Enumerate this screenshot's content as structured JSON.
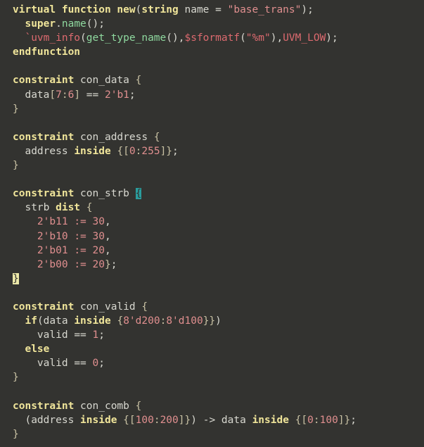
{
  "editor": {
    "language": "SystemVerilog",
    "theme": "dark-warm-gray",
    "background": "#333330",
    "bracket_match_open_bg": "#2a9d9d",
    "bracket_match_close_bg": "#ece8a8",
    "colors": {
      "keyword": "#f0e59a",
      "identifier": "#d8d8d0",
      "function": "#8fd99f",
      "macro": "#dd6a6f",
      "string": "#e08f8f",
      "number": "#e08f8f",
      "punctuation": "#c9c2a4"
    }
  },
  "code": {
    "lines": [
      {
        "n": 1,
        "tokens": [
          {
            "t": "kw",
            "v": "virtual"
          },
          {
            "t": "id",
            "v": " "
          },
          {
            "t": "kw",
            "v": "function"
          },
          {
            "t": "id",
            "v": " "
          },
          {
            "t": "kw",
            "v": "new"
          },
          {
            "t": "op",
            "v": "("
          },
          {
            "t": "kw",
            "v": "string"
          },
          {
            "t": "id",
            "v": " name "
          },
          {
            "t": "op",
            "v": "= "
          },
          {
            "t": "str",
            "v": "\"base_trans\""
          },
          {
            "t": "op",
            "v": ");"
          }
        ]
      },
      {
        "n": 2,
        "tokens": [
          {
            "t": "id",
            "v": "  "
          },
          {
            "t": "kw",
            "v": "super"
          },
          {
            "t": "op",
            "v": "."
          },
          {
            "t": "fn",
            "v": "name"
          },
          {
            "t": "op",
            "v": "();"
          }
        ]
      },
      {
        "n": 3,
        "tokens": [
          {
            "t": "id",
            "v": "  "
          },
          {
            "t": "mac",
            "v": "`uvm_info"
          },
          {
            "t": "op",
            "v": "("
          },
          {
            "t": "fn",
            "v": "get_type_name"
          },
          {
            "t": "op",
            "v": "(),"
          },
          {
            "t": "mac",
            "v": "$sformatf"
          },
          {
            "t": "op",
            "v": "("
          },
          {
            "t": "mac",
            "v": "\"%m\""
          },
          {
            "t": "op",
            "v": "),"
          },
          {
            "t": "mac",
            "v": "UVM_LOW"
          },
          {
            "t": "op",
            "v": ");"
          }
        ]
      },
      {
        "n": 4,
        "tokens": [
          {
            "t": "kw",
            "v": "endfunction"
          }
        ]
      },
      {
        "n": 5,
        "tokens": []
      },
      {
        "n": 6,
        "tokens": [
          {
            "t": "kw",
            "v": "constraint"
          },
          {
            "t": "id",
            "v": " con_data "
          },
          {
            "t": "pun",
            "v": "{"
          }
        ]
      },
      {
        "n": 7,
        "tokens": [
          {
            "t": "id",
            "v": "  data"
          },
          {
            "t": "pun",
            "v": "["
          },
          {
            "t": "num",
            "v": "7"
          },
          {
            "t": "pun",
            "v": ":"
          },
          {
            "t": "num",
            "v": "6"
          },
          {
            "t": "pun",
            "v": "]"
          },
          {
            "t": "op",
            "v": " == "
          },
          {
            "t": "num",
            "v": "2'b1"
          },
          {
            "t": "op",
            "v": ";"
          }
        ]
      },
      {
        "n": 8,
        "tokens": [
          {
            "t": "pun",
            "v": "}"
          }
        ]
      },
      {
        "n": 9,
        "tokens": []
      },
      {
        "n": 10,
        "tokens": [
          {
            "t": "kw",
            "v": "constraint"
          },
          {
            "t": "id",
            "v": " con_address "
          },
          {
            "t": "pun",
            "v": "{"
          }
        ]
      },
      {
        "n": 11,
        "tokens": [
          {
            "t": "id",
            "v": "  address "
          },
          {
            "t": "kw",
            "v": "inside"
          },
          {
            "t": "id",
            "v": " "
          },
          {
            "t": "pun",
            "v": "{["
          },
          {
            "t": "num",
            "v": "0"
          },
          {
            "t": "pun",
            "v": ":"
          },
          {
            "t": "num",
            "v": "255"
          },
          {
            "t": "pun",
            "v": "]}"
          },
          {
            "t": "op",
            "v": ";"
          }
        ]
      },
      {
        "n": 12,
        "tokens": [
          {
            "t": "pun",
            "v": "}"
          }
        ]
      },
      {
        "n": 13,
        "tokens": []
      },
      {
        "n": 14,
        "tokens": [
          {
            "t": "kw",
            "v": "constraint"
          },
          {
            "t": "id",
            "v": " con_strb "
          },
          {
            "t": "hl-open",
            "v": "{"
          }
        ]
      },
      {
        "n": 15,
        "tokens": [
          {
            "t": "id",
            "v": "  strb "
          },
          {
            "t": "kw",
            "v": "dist"
          },
          {
            "t": "id",
            "v": " "
          },
          {
            "t": "pun",
            "v": "{"
          }
        ]
      },
      {
        "n": 16,
        "tokens": [
          {
            "t": "id",
            "v": "    "
          },
          {
            "t": "num",
            "v": "2'b11"
          },
          {
            "t": "op",
            "v": " "
          },
          {
            "t": "num",
            "v": ":="
          },
          {
            "t": "op",
            "v": " "
          },
          {
            "t": "num",
            "v": "30"
          },
          {
            "t": "op",
            "v": ","
          }
        ]
      },
      {
        "n": 17,
        "tokens": [
          {
            "t": "id",
            "v": "    "
          },
          {
            "t": "num",
            "v": "2'b10"
          },
          {
            "t": "op",
            "v": " "
          },
          {
            "t": "num",
            "v": ":="
          },
          {
            "t": "op",
            "v": " "
          },
          {
            "t": "num",
            "v": "30"
          },
          {
            "t": "op",
            "v": ","
          }
        ]
      },
      {
        "n": 18,
        "tokens": [
          {
            "t": "id",
            "v": "    "
          },
          {
            "t": "num",
            "v": "2'b01"
          },
          {
            "t": "op",
            "v": " "
          },
          {
            "t": "num",
            "v": ":="
          },
          {
            "t": "op",
            "v": " "
          },
          {
            "t": "num",
            "v": "20"
          },
          {
            "t": "op",
            "v": ","
          }
        ]
      },
      {
        "n": 19,
        "tokens": [
          {
            "t": "id",
            "v": "    "
          },
          {
            "t": "num",
            "v": "2'b00"
          },
          {
            "t": "op",
            "v": " "
          },
          {
            "t": "num",
            "v": ":="
          },
          {
            "t": "op",
            "v": " "
          },
          {
            "t": "num",
            "v": "20"
          },
          {
            "t": "pun",
            "v": "}"
          },
          {
            "t": "op",
            "v": ";"
          }
        ]
      },
      {
        "n": 20,
        "tokens": [
          {
            "t": "hl-close",
            "v": "}"
          }
        ]
      },
      {
        "n": 21,
        "tokens": []
      },
      {
        "n": 22,
        "tokens": [
          {
            "t": "kw",
            "v": "constraint"
          },
          {
            "t": "id",
            "v": " con_valid "
          },
          {
            "t": "pun",
            "v": "{"
          }
        ]
      },
      {
        "n": 23,
        "tokens": [
          {
            "t": "id",
            "v": "  "
          },
          {
            "t": "kw",
            "v": "if"
          },
          {
            "t": "op",
            "v": "("
          },
          {
            "t": "id",
            "v": "data "
          },
          {
            "t": "kw",
            "v": "inside"
          },
          {
            "t": "id",
            "v": " "
          },
          {
            "t": "pun",
            "v": "{"
          },
          {
            "t": "num",
            "v": "8'd200"
          },
          {
            "t": "pun",
            "v": ":"
          },
          {
            "t": "num",
            "v": "8'd100"
          },
          {
            "t": "pun",
            "v": "}}"
          },
          {
            "t": "op",
            "v": ")"
          }
        ]
      },
      {
        "n": 24,
        "tokens": [
          {
            "t": "id",
            "v": "    valid "
          },
          {
            "t": "op",
            "v": "== "
          },
          {
            "t": "num",
            "v": "1"
          },
          {
            "t": "op",
            "v": ";"
          }
        ]
      },
      {
        "n": 25,
        "tokens": [
          {
            "t": "id",
            "v": "  "
          },
          {
            "t": "kw",
            "v": "else"
          }
        ]
      },
      {
        "n": 26,
        "tokens": [
          {
            "t": "id",
            "v": "    valid "
          },
          {
            "t": "op",
            "v": "== "
          },
          {
            "t": "num",
            "v": "0"
          },
          {
            "t": "op",
            "v": ";"
          }
        ]
      },
      {
        "n": 27,
        "tokens": [
          {
            "t": "pun",
            "v": "}"
          }
        ]
      },
      {
        "n": 28,
        "tokens": []
      },
      {
        "n": 29,
        "tokens": [
          {
            "t": "kw",
            "v": "constraint"
          },
          {
            "t": "id",
            "v": " con_comb "
          },
          {
            "t": "pun",
            "v": "{"
          }
        ]
      },
      {
        "n": 30,
        "tokens": [
          {
            "t": "id",
            "v": "  "
          },
          {
            "t": "op",
            "v": "("
          },
          {
            "t": "id",
            "v": "address "
          },
          {
            "t": "kw",
            "v": "inside"
          },
          {
            "t": "id",
            "v": " "
          },
          {
            "t": "pun",
            "v": "{["
          },
          {
            "t": "num",
            "v": "100"
          },
          {
            "t": "pun",
            "v": ":"
          },
          {
            "t": "num",
            "v": "200"
          },
          {
            "t": "pun",
            "v": "]}"
          },
          {
            "t": "op",
            "v": ") -> "
          },
          {
            "t": "id",
            "v": "data "
          },
          {
            "t": "kw",
            "v": "inside"
          },
          {
            "t": "id",
            "v": " "
          },
          {
            "t": "pun",
            "v": "{["
          },
          {
            "t": "num",
            "v": "0"
          },
          {
            "t": "pun",
            "v": ":"
          },
          {
            "t": "num",
            "v": "100"
          },
          {
            "t": "pun",
            "v": "]}"
          },
          {
            "t": "op",
            "v": ";"
          }
        ]
      },
      {
        "n": 31,
        "tokens": [
          {
            "t": "pun",
            "v": "}"
          }
        ]
      }
    ],
    "plain_text": "virtual function new(string name = \"base_trans\");\n  super.name();\n  `uvm_info(get_type_name(),$sformatf(\"%m\"),UVM_LOW);\nendfunction\n\nconstraint con_data {\n  data[7:6] == 2'b1;\n}\n\nconstraint con_address {\n  address inside {[0:255]};\n}\n\nconstraint con_strb {\n  strb dist {\n    2'b11 := 30,\n    2'b10 := 30,\n    2'b01 := 20,\n    2'b00 := 20};\n}\n\nconstraint con_valid {\n  if(data inside {8'd200:8'd100})\n    valid == 1;\n  else\n    valid == 0;\n}\n\nconstraint con_comb {\n  (address inside {[100:200]}) -> data inside {[0:100]};\n}"
  }
}
